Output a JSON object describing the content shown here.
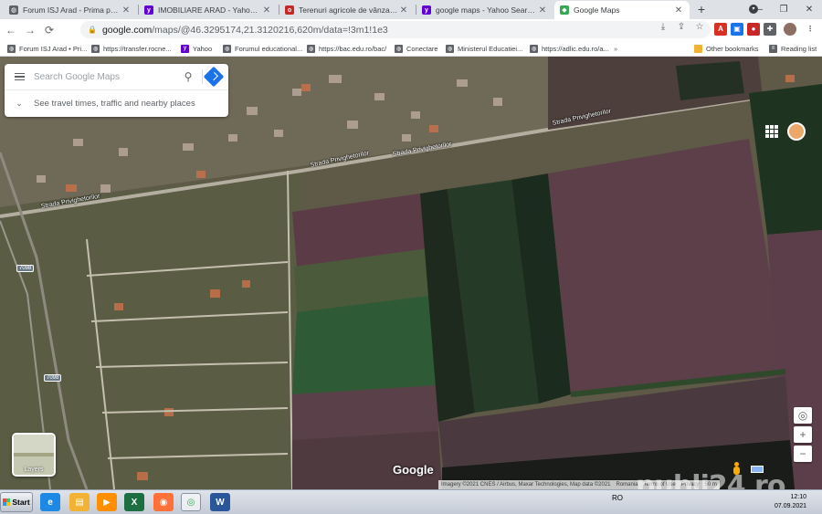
{
  "browser": {
    "tabs": [
      {
        "title": "Forum ISJ Arad - Prima pagină",
        "icon": "globe-icon",
        "color": "#5f6368"
      },
      {
        "title": "IMOBILIARE ARAD - Yahoo Search R",
        "icon": "yahoo-icon",
        "color": "#6001d2"
      },
      {
        "title": "Terenuri agricole de vânzare în județ",
        "icon": "olx-icon",
        "color": "#c62828"
      },
      {
        "title": "google maps - Yahoo Search Results",
        "icon": "yahoo-icon",
        "color": "#6001d2"
      },
      {
        "title": "Google Maps",
        "icon": "maps-icon",
        "color": "#34a853"
      }
    ],
    "new_tab_label": "+",
    "window_controls": {
      "minimize": "—",
      "maximize": "❐",
      "close": "✕"
    },
    "nav": {
      "back": "←",
      "forward": "→",
      "reload": "⟳"
    },
    "address": {
      "host": "google.com",
      "path": "/maps/@46.3295174,21.3120216,620m/data=!3m1!1e3"
    },
    "bookmarks": [
      {
        "label": "Forum ISJ Arad • Pri...",
        "icon": "globe-icon",
        "color": "#5f6368"
      },
      {
        "label": "https://transfer.rocne...",
        "icon": "globe-icon",
        "color": "#5f6368"
      },
      {
        "label": "Yahoo",
        "icon": "yahoo-icon",
        "color": "#6001d2"
      },
      {
        "label": "Forumul educational...",
        "icon": "globe-icon",
        "color": "#5f6368"
      },
      {
        "label": "https://bac.edu.ro/bac/",
        "icon": "globe-icon",
        "color": "#5f6368"
      },
      {
        "label": "Conectare",
        "icon": "globe-icon",
        "color": "#5f6368"
      },
      {
        "label": "Ministerul Educatiei...",
        "icon": "globe-icon",
        "color": "#5f6368"
      },
      {
        "label": "https://adlic.edu.ro/a...",
        "icon": "globe-icon",
        "color": "#5f6368"
      }
    ],
    "other_bookmarks": "Other bookmarks",
    "reading_list": "Reading list"
  },
  "maps": {
    "search_placeholder": "Search Google Maps",
    "travel_times": "See travel times, traffic and nearby places",
    "layers_label": "Layers",
    "logo": "Google",
    "street_label_1": "Strada Privighetorilor",
    "street_label_2": "Strada Privighetorilor",
    "street_label_3": "Strada Privighetorilor",
    "street_label_4": "Strada Privighetorilor",
    "shield_1": "7098",
    "shield_2": "7098",
    "attribution": [
      "Imagery ©2021 CNES / Airbus, Maxar Technologies, Map data ©2021",
      "Romania",
      "Terms of Use",
      "Privacy"
    ],
    "scale": "50 m",
    "zoom_in": "+",
    "zoom_out": "−"
  },
  "watermark": "publi24.ro",
  "taskbar": {
    "start": "Start",
    "apps": [
      {
        "name": "ie-icon",
        "glyph": "e",
        "color": "#1e88e5"
      },
      {
        "name": "explorer-icon",
        "glyph": "▤",
        "color": "#f2b233"
      },
      {
        "name": "media-player-icon",
        "glyph": "▶",
        "color": "#ff8f00"
      },
      {
        "name": "excel-icon",
        "glyph": "X",
        "color": "#1d6f42"
      },
      {
        "name": "firefox-icon",
        "glyph": "◉",
        "color": "#ff7139"
      },
      {
        "name": "chrome-icon",
        "glyph": "◎",
        "color": "#34a853"
      },
      {
        "name": "word-icon",
        "glyph": "W",
        "color": "#2b579a"
      }
    ],
    "language": "RO",
    "time": "12:10",
    "date": "07.09.2021"
  }
}
